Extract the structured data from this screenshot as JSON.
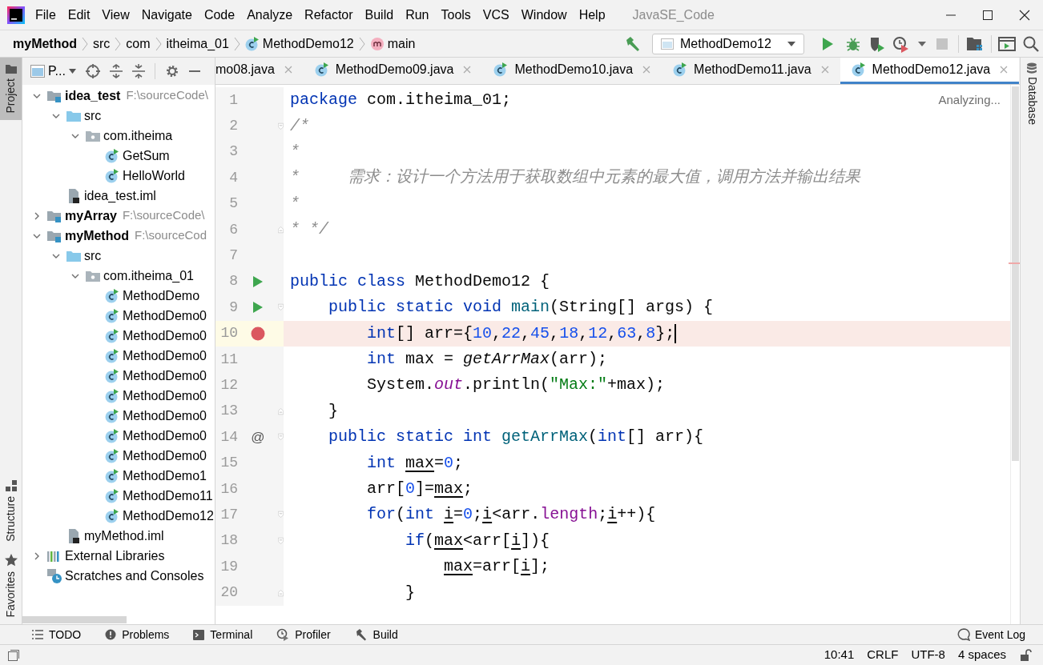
{
  "window": {
    "title": "JavaSE_Code"
  },
  "menu": [
    "File",
    "Edit",
    "View",
    "Navigate",
    "Code",
    "Analyze",
    "Refactor",
    "Build",
    "Run",
    "Tools",
    "VCS",
    "Window",
    "Help"
  ],
  "breadcrumbs": [
    {
      "label": "myMethod",
      "kind": "module"
    },
    {
      "label": "src",
      "kind": "plain"
    },
    {
      "label": "com",
      "kind": "plain"
    },
    {
      "label": "itheima_01",
      "kind": "plain"
    },
    {
      "label": "MethodDemo12",
      "kind": "class"
    },
    {
      "label": "main",
      "kind": "method"
    }
  ],
  "run_config": {
    "value": "MethodDemo12"
  },
  "side_tabs": [
    {
      "label": "Project",
      "selected": true
    },
    {
      "label": "Structure",
      "selected": false
    },
    {
      "label": "Favorites",
      "selected": false
    }
  ],
  "project_panel": {
    "title": "P..."
  },
  "tree": [
    {
      "label": "idea_test",
      "path": "F:\\sourceCode\\",
      "kind": "module",
      "expanded": true,
      "children": [
        {
          "label": "src",
          "kind": "folder",
          "expanded": true,
          "children": [
            {
              "label": "com.itheima",
              "kind": "package",
              "expanded": true,
              "children": [
                {
                  "label": "GetSum",
                  "kind": "class"
                },
                {
                  "label": "HelloWorld",
                  "kind": "class"
                }
              ]
            }
          ]
        },
        {
          "label": "idea_test.iml",
          "kind": "iml"
        }
      ]
    },
    {
      "label": "myArray",
      "path": "F:\\sourceCode\\",
      "kind": "module",
      "expanded": false
    },
    {
      "label": "myMethod",
      "path": "F:\\sourceCod",
      "kind": "module",
      "expanded": true,
      "children": [
        {
          "label": "src",
          "kind": "folder",
          "expanded": true,
          "children": [
            {
              "label": "com.itheima_01",
              "kind": "package",
              "expanded": true,
              "children": [
                {
                  "label": "MethodDemo",
                  "kind": "class"
                },
                {
                  "label": "MethodDemo0",
                  "kind": "class"
                },
                {
                  "label": "MethodDemo0",
                  "kind": "class"
                },
                {
                  "label": "MethodDemo0",
                  "kind": "class"
                },
                {
                  "label": "MethodDemo0",
                  "kind": "class"
                },
                {
                  "label": "MethodDemo0",
                  "kind": "class"
                },
                {
                  "label": "MethodDemo0",
                  "kind": "class"
                },
                {
                  "label": "MethodDemo0",
                  "kind": "class"
                },
                {
                  "label": "MethodDemo0",
                  "kind": "class"
                },
                {
                  "label": "MethodDemo1",
                  "kind": "class"
                },
                {
                  "label": "MethodDemo11",
                  "kind": "class"
                },
                {
                  "label": "MethodDemo12",
                  "kind": "class"
                }
              ]
            }
          ]
        },
        {
          "label": "myMethod.iml",
          "kind": "iml"
        }
      ]
    },
    {
      "label": "External Libraries",
      "kind": "libraries",
      "expanded": false
    },
    {
      "label": "Scratches and Consoles",
      "kind": "scratches"
    }
  ],
  "editor_tabs": [
    {
      "label": "mo08.java",
      "icon": false,
      "selected": false
    },
    {
      "label": "MethodDemo09.java",
      "icon": true,
      "selected": false
    },
    {
      "label": "MethodDemo10.java",
      "icon": true,
      "selected": false
    },
    {
      "label": "MethodDemo11.java",
      "icon": true,
      "selected": false
    },
    {
      "label": "MethodDemo12.java",
      "icon": true,
      "selected": true
    }
  ],
  "editor_status": "Analyzing...",
  "code": [
    {
      "number": "1",
      "highlighted": false,
      "caret": false,
      "tokens": [
        {
          "kind": "keyword",
          "text": "package"
        },
        {
          "kind": "plain",
          "text": " com.itheima_01;"
        }
      ]
    },
    {
      "number": "2",
      "highlighted": false,
      "caret": false,
      "fold": {
        "kind": "open"
      },
      "tokens": [
        {
          "kind": "comment",
          "text": "/*"
        }
      ]
    },
    {
      "number": "3",
      "highlighted": false,
      "caret": false,
      "tokens": [
        {
          "kind": "comment",
          "text": "*"
        }
      ]
    },
    {
      "number": "4",
      "highlighted": false,
      "caret": false,
      "tokens": [
        {
          "kind": "comment",
          "text": "*     需求：设计一个方法用于获取数组中元素的最大值，调用方法并输出结果"
        }
      ]
    },
    {
      "number": "5",
      "highlighted": false,
      "caret": false,
      "tokens": [
        {
          "kind": "comment",
          "text": "*"
        }
      ]
    },
    {
      "number": "6",
      "highlighted": false,
      "caret": false,
      "fold": {
        "kind": "end"
      },
      "tokens": [
        {
          "kind": "comment",
          "text": "* */"
        }
      ]
    },
    {
      "number": "7",
      "highlighted": false,
      "caret": false
    },
    {
      "number": "8",
      "highlighted": false,
      "caret": false,
      "gutter": {
        "kind": "run"
      },
      "tokens": [
        {
          "kind": "keyword",
          "text": "public class"
        },
        {
          "kind": "plain",
          "text": " MethodDemo12 {"
        }
      ]
    },
    {
      "number": "9",
      "highlighted": false,
      "caret": false,
      "gutter": {
        "kind": "run"
      },
      "fold": {
        "kind": "open"
      },
      "tokens": [
        {
          "kind": "keyword",
          "text": "public static void "
        },
        {
          "kind": "method_decl",
          "text": "main"
        },
        {
          "kind": "plain",
          "text": "(String[] args) {"
        }
      ]
    },
    {
      "number": "10",
      "highlighted": true,
      "caret": true,
      "gutter": {
        "kind": "breakpoint"
      },
      "tokens": [
        {
          "kind": "keyword",
          "text": "int"
        },
        {
          "kind": "plain",
          "text": "[] arr={"
        },
        {
          "kind": "number",
          "text": "10"
        },
        {
          "kind": "plain",
          "text": ","
        },
        {
          "kind": "number",
          "text": "22"
        },
        {
          "kind": "plain",
          "text": ","
        },
        {
          "kind": "number",
          "text": "45"
        },
        {
          "kind": "plain",
          "text": ","
        },
        {
          "kind": "number",
          "text": "18"
        },
        {
          "kind": "plain",
          "text": ","
        },
        {
          "kind": "number",
          "text": "12"
        },
        {
          "kind": "plain",
          "text": ","
        },
        {
          "kind": "number",
          "text": "63"
        },
        {
          "kind": "plain",
          "text": ","
        },
        {
          "kind": "number",
          "text": "8"
        },
        {
          "kind": "plain",
          "text": "};"
        }
      ]
    },
    {
      "number": "11",
      "highlighted": false,
      "caret": false,
      "tokens": [
        {
          "kind": "keyword",
          "text": "int"
        },
        {
          "kind": "plain",
          "text": " max = "
        },
        {
          "kind": "static_call",
          "text": "getArrMax"
        },
        {
          "kind": "plain",
          "text": "(arr);"
        }
      ]
    },
    {
      "number": "12",
      "highlighted": false,
      "caret": false,
      "tokens": [
        {
          "kind": "plain",
          "text": "System."
        },
        {
          "kind": "static_field",
          "text": "out"
        },
        {
          "kind": "plain",
          "text": ".println("
        },
        {
          "kind": "string",
          "text": "\"Max:\""
        },
        {
          "kind": "plain",
          "text": "+max);"
        }
      ]
    },
    {
      "number": "13",
      "highlighted": false,
      "caret": false,
      "fold": {
        "kind": "end"
      },
      "tokens": [
        {
          "kind": "plain",
          "text": "}"
        }
      ]
    },
    {
      "number": "14",
      "highlighted": false,
      "caret": false,
      "gutter": {
        "kind": "override",
        "text": "@"
      },
      "fold": {
        "kind": "open"
      },
      "tokens": [
        {
          "kind": "keyword",
          "text": "public static int "
        },
        {
          "kind": "method_decl",
          "text": "getArrMax"
        },
        {
          "kind": "plain",
          "text": "("
        },
        {
          "kind": "keyword",
          "text": "int"
        },
        {
          "kind": "plain",
          "text": "[] arr){"
        }
      ]
    },
    {
      "number": "15",
      "highlighted": false,
      "caret": false,
      "tokens": [
        {
          "kind": "keyword",
          "text": "int "
        },
        {
          "kind": "reassigned",
          "text": "max"
        },
        {
          "kind": "plain",
          "text": "="
        },
        {
          "kind": "number",
          "text": "0"
        },
        {
          "kind": "plain",
          "text": ";"
        }
      ]
    },
    {
      "number": "16",
      "highlighted": false,
      "caret": false,
      "tokens": [
        {
          "kind": "plain",
          "text": "arr["
        },
        {
          "kind": "number",
          "text": "0"
        },
        {
          "kind": "plain",
          "text": "]="
        },
        {
          "kind": "reassigned",
          "text": "max"
        },
        {
          "kind": "plain",
          "text": ";"
        }
      ]
    },
    {
      "number": "17",
      "highlighted": false,
      "caret": false,
      "fold": {
        "kind": "open"
      },
      "tokens": [
        {
          "kind": "keyword",
          "text": "for"
        },
        {
          "kind": "plain",
          "text": "("
        },
        {
          "kind": "keyword",
          "text": "int "
        },
        {
          "kind": "reassigned",
          "text": "i"
        },
        {
          "kind": "plain",
          "text": "="
        },
        {
          "kind": "number",
          "text": "0"
        },
        {
          "kind": "plain",
          "text": ";"
        },
        {
          "kind": "reassigned",
          "text": "i"
        },
        {
          "kind": "plain",
          "text": "<arr."
        },
        {
          "kind": "field",
          "text": "length"
        },
        {
          "kind": "plain",
          "text": ";"
        },
        {
          "kind": "reassigned",
          "text": "i"
        },
        {
          "kind": "plain",
          "text": "++){"
        }
      ]
    },
    {
      "number": "18",
      "highlighted": false,
      "caret": false,
      "fold": {
        "kind": "open"
      },
      "tokens": [
        {
          "kind": "keyword",
          "text": "if"
        },
        {
          "kind": "plain",
          "text": "("
        },
        {
          "kind": "reassigned",
          "text": "max"
        },
        {
          "kind": "plain",
          "text": "<arr["
        },
        {
          "kind": "reassigned",
          "text": "i"
        },
        {
          "kind": "plain",
          "text": "]){"
        }
      ]
    },
    {
      "number": "19",
      "highlighted": false,
      "caret": false,
      "tokens": [
        {
          "kind": "reassigned",
          "text": "max"
        },
        {
          "kind": "plain",
          "text": "=arr["
        },
        {
          "kind": "reassigned",
          "text": "i"
        },
        {
          "kind": "plain",
          "text": "];"
        }
      ]
    },
    {
      "number": "20",
      "highlighted": false,
      "caret": false,
      "fold": {
        "kind": "end"
      },
      "tokens": [
        {
          "kind": "plain",
          "text": "}"
        }
      ]
    }
  ],
  "right_stripe": {
    "label": "Database"
  },
  "tool_windows": [
    {
      "label": "TODO",
      "kind": "todo"
    },
    {
      "label": "Problems",
      "kind": "problems"
    },
    {
      "label": "Terminal",
      "kind": "terminal"
    },
    {
      "label": "Profiler",
      "kind": "profiler"
    },
    {
      "label": "Build",
      "kind": "build"
    }
  ],
  "event_log": "Event Log",
  "status_bar": [
    "10:41",
    "CRLF",
    "UTF-8",
    "4 spaces"
  ]
}
